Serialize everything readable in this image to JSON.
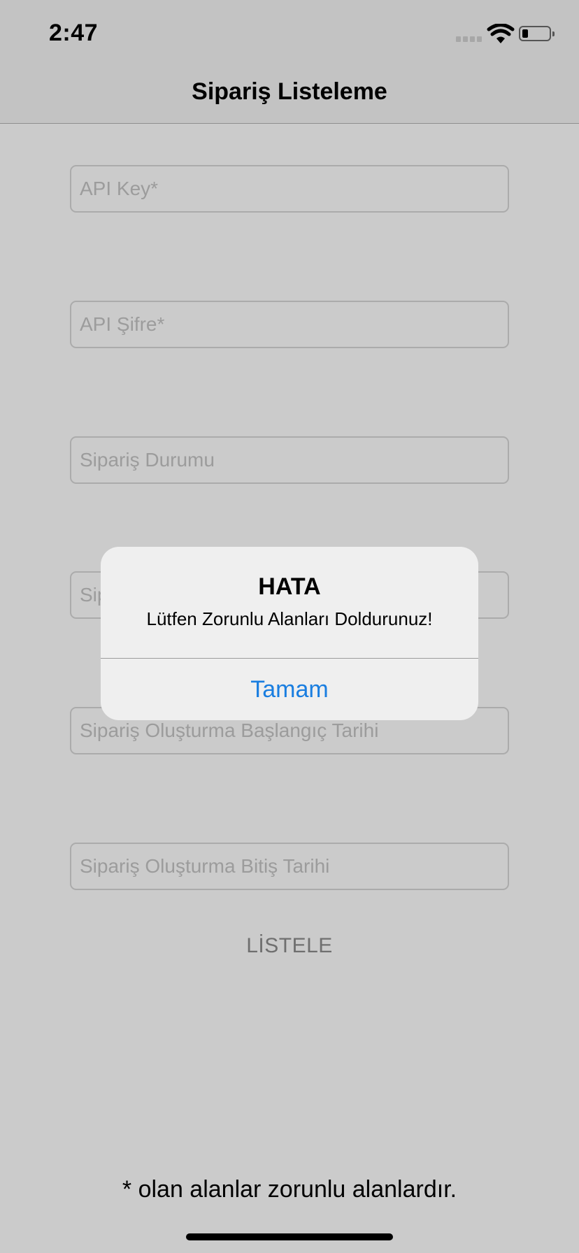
{
  "status_bar": {
    "time": "2:47"
  },
  "nav": {
    "title": "Sipariş Listeleme"
  },
  "form": {
    "fields": [
      {
        "placeholder": "API Key*",
        "value": ""
      },
      {
        "placeholder": "API Şifre*",
        "value": ""
      },
      {
        "placeholder": "Sipariş Durumu",
        "value": ""
      },
      {
        "placeholder": "Sipariş Numarası",
        "value": ""
      },
      {
        "placeholder": "Sipariş Oluşturma Başlangıç Tarihi",
        "value": ""
      },
      {
        "placeholder": "Sipariş Oluşturma Bitiş Tarihi",
        "value": ""
      }
    ],
    "list_button": "LİSTELE"
  },
  "footer": {
    "note": "* olan alanlar zorunlu alanlardır."
  },
  "alert": {
    "title": "HATA",
    "message": "Lütfen Zorunlu Alanları Doldurunuz!",
    "button": "Tamam"
  },
  "colors": {
    "accent": "#1a7ee0",
    "dimmed_background": "#cbcbcb",
    "alert_background": "#efefef"
  }
}
